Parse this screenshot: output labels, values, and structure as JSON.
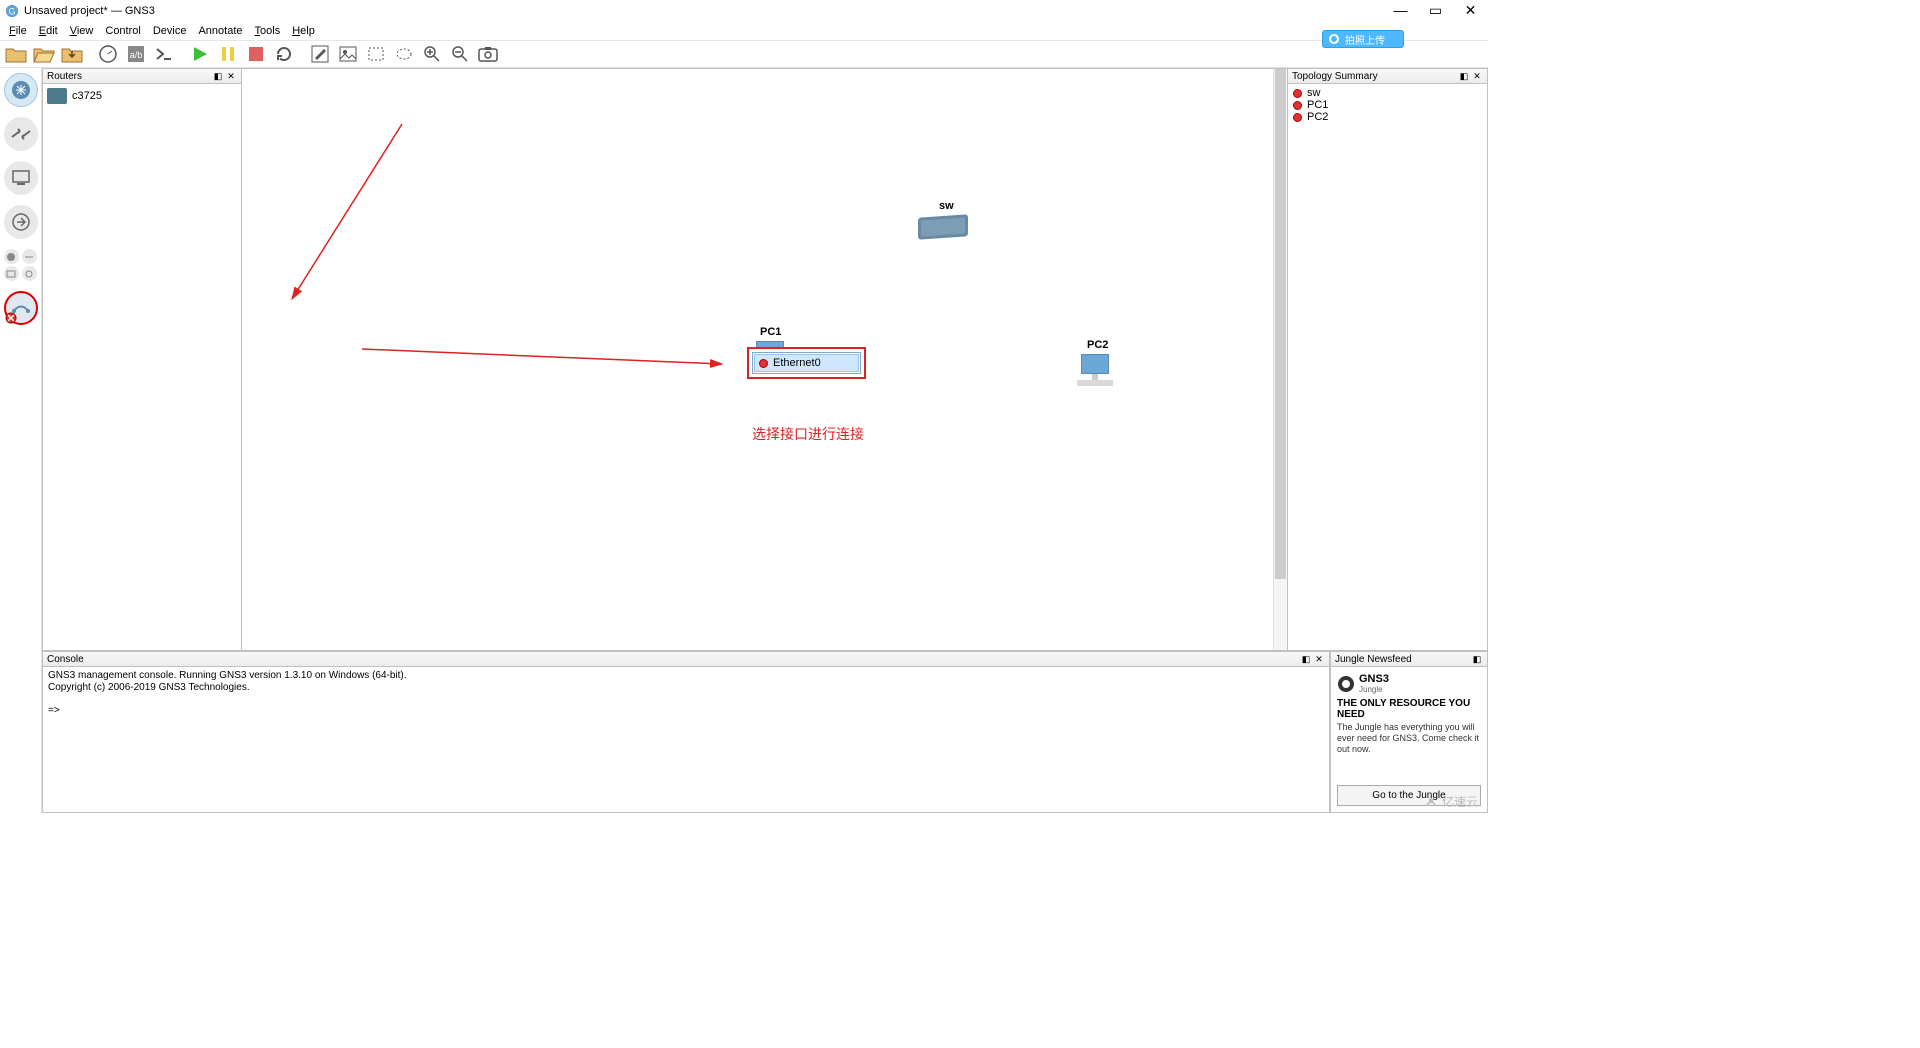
{
  "window": {
    "title": "Unsaved project* — GNS3"
  },
  "menu": {
    "file": "File",
    "edit": "Edit",
    "view": "View",
    "control": "Control",
    "device": "Device",
    "annotate": "Annotate",
    "tools": "Tools",
    "help": "Help"
  },
  "upload_btn": "拍照上传",
  "panels": {
    "routers_title": "Routers",
    "topology_title": "Topology Summary",
    "console_title": "Console",
    "newsfeed_title": "Jungle Newsfeed"
  },
  "routers": {
    "items": [
      {
        "label": "c3725"
      }
    ]
  },
  "canvas": {
    "sw_label": "sw",
    "pc1_label": "PC1",
    "pc2_label": "PC2",
    "ctx_item": "Ethernet0",
    "annotation": "选择接口进行连接"
  },
  "topology": {
    "items": [
      {
        "label": "sw"
      },
      {
        "label": "PC1"
      },
      {
        "label": "PC2"
      }
    ]
  },
  "console": {
    "line1": "GNS3 management console. Running GNS3 version 1.3.10 on Windows (64-bit).",
    "line2": "Copyright (c) 2006-2019 GNS3 Technologies.",
    "prompt": "=>"
  },
  "newsfeed": {
    "brand": "GNS3",
    "brand_sub": "Jungle",
    "headline": "THE ONLY RESOURCE YOU NEED",
    "body": "The Jungle has everything you will ever need for GNS3. Come check it out now.",
    "cta": "Go to the Jungle"
  },
  "watermark": "亿速云"
}
